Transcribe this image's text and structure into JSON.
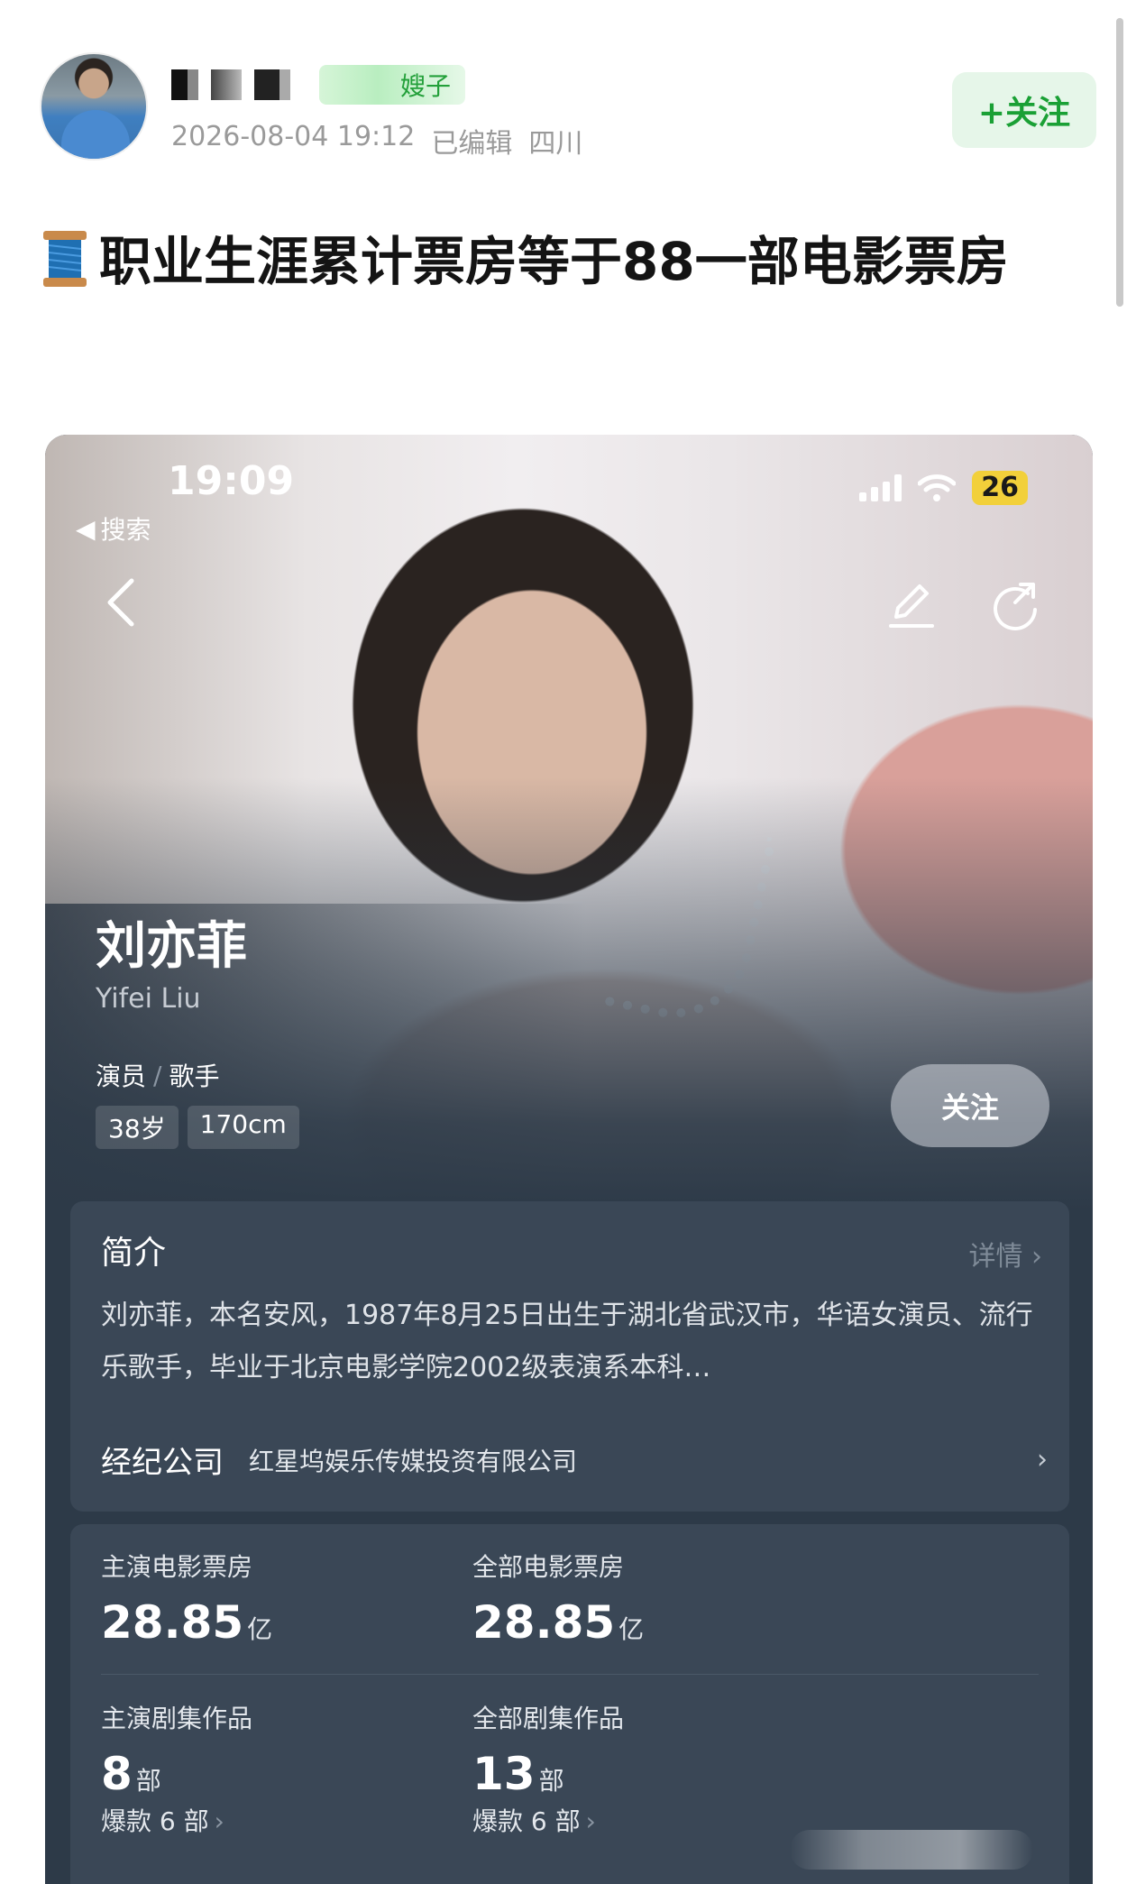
{
  "post": {
    "badge_text": "嫂子",
    "timestamp": "2026-08-04 19:12",
    "edited_label": "已编辑",
    "location": "四川",
    "follow_label": "+关注",
    "title": "职业生涯累计票房等于88一部电影票房",
    "title_icon": "spool-of-thread-icon"
  },
  "screenshot": {
    "status_bar": {
      "time": "19:09",
      "battery": "26"
    },
    "back_nav_label": "搜索",
    "star": {
      "name": "刘亦菲",
      "english_name": "Yifei Liu",
      "roles": [
        "演员",
        "歌手"
      ],
      "role_separator": "/",
      "tags": [
        "38岁",
        "170cm"
      ],
      "follow_label": "关注"
    },
    "intro": {
      "title": "简介",
      "detail_label": "详情",
      "text": "刘亦菲，本名安风，1987年8月25日出生于湖北省武汉市，华语女演员、流行乐歌手，毕业于北京电影学院2002级表演系本科…",
      "agency_label": "经纪公司",
      "agency_name": "红星坞娱乐传媒投资有限公司"
    },
    "stats": [
      {
        "label": "主演电影票房",
        "value": "28.85",
        "unit": "亿"
      },
      {
        "label": "全部电影票房",
        "value": "28.85",
        "unit": "亿"
      },
      {
        "label": "主演剧集作品",
        "value": "8",
        "unit": "部",
        "sub": "爆款 6 部"
      },
      {
        "label": "全部剧集作品",
        "value": "13",
        "unit": "部",
        "sub": "爆款 6 部"
      }
    ]
  }
}
